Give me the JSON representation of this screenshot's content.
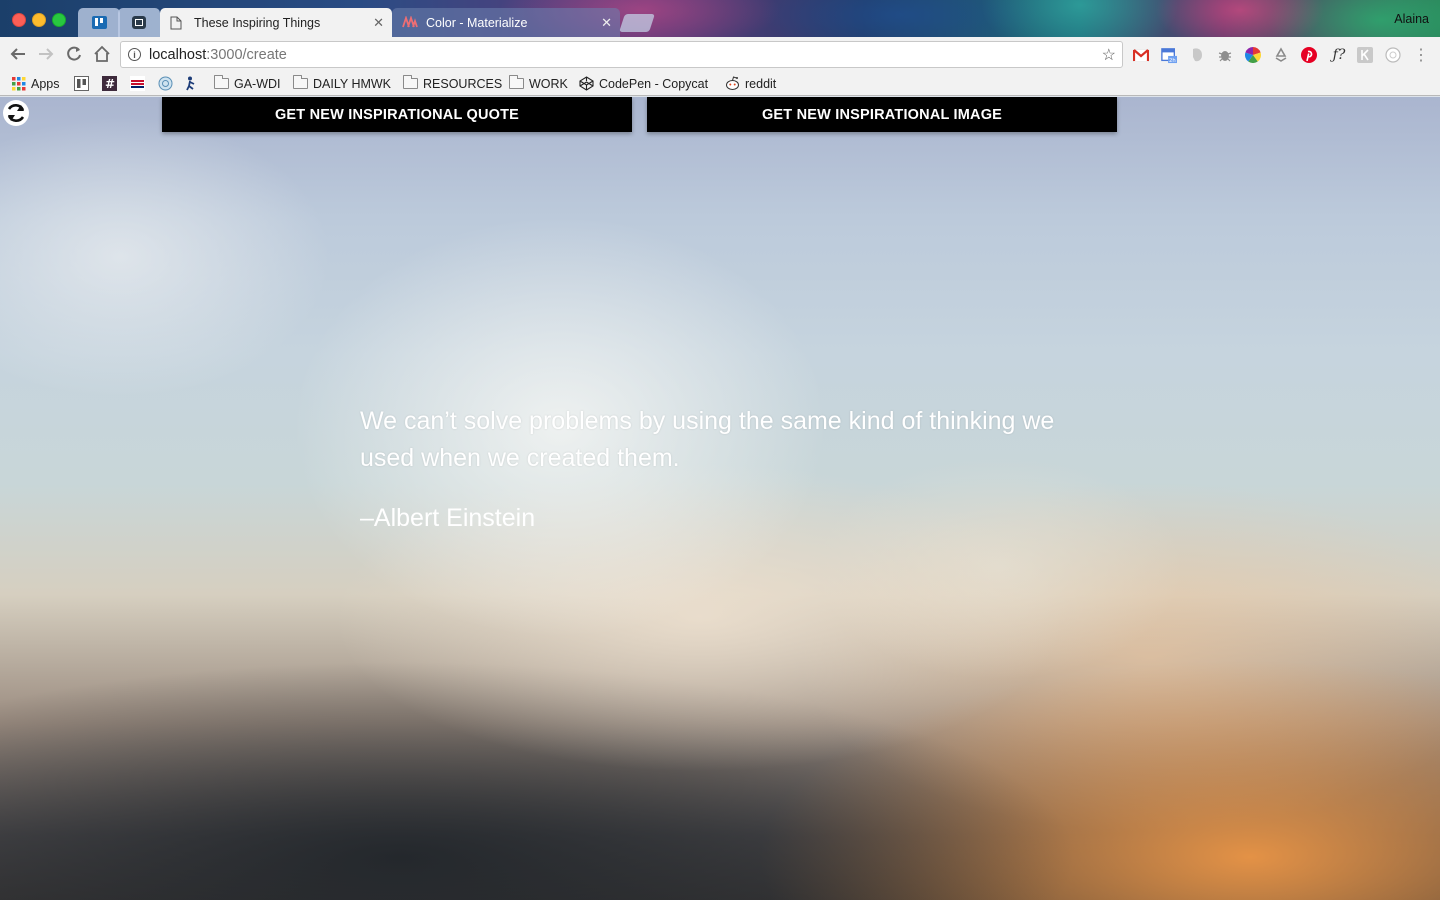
{
  "browser": {
    "tabs": [
      {
        "label": "These Inspiring Things",
        "active": true
      },
      {
        "label": "Color - Materialize",
        "active": false
      }
    ],
    "profile_name": "Alaina",
    "address": {
      "host": "localhost",
      "path": ":3000/create"
    },
    "bookmarks": [
      "Apps",
      "GA-WDI",
      "DAILY HMWK",
      "RESOURCES",
      "WORK",
      "CodePen - Copycat",
      "reddit"
    ],
    "extensions": [
      "gmail-icon",
      "calendar-icon",
      "evernote-icon",
      "bug-icon",
      "color-wheel-icon",
      "recycle-icon",
      "pinterest-icon",
      "whatfont-icon",
      "k-extension-icon",
      "circle-extension-icon",
      "menu-icon"
    ]
  },
  "page": {
    "buttons": {
      "quote": "GET NEW INSPIRATIONAL QUOTE",
      "image": "GET NEW INSPIRATIONAL IMAGE"
    },
    "quote": {
      "text": "We can’t solve problems by using the same kind of thinking we used when we created them.",
      "author": "–Albert Einstein"
    }
  },
  "colors": {
    "button_bg": "#000000",
    "button_text": "#ffffff",
    "quote_text": "#ffffff",
    "gmail_red": "#d93025",
    "pinterest_red": "#e60023"
  }
}
